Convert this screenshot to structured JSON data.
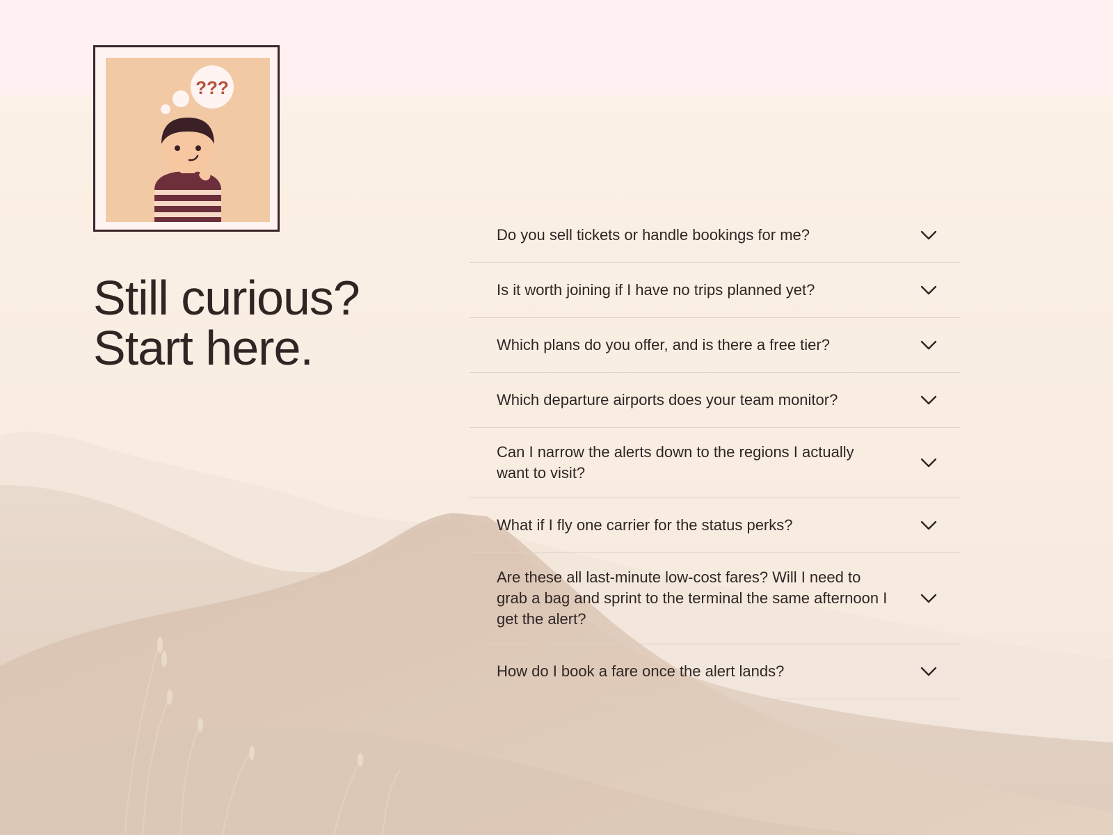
{
  "colors": {
    "top_band": "#fff0f1",
    "page_background": "#fbf1e6",
    "heading_text": "#2f2624",
    "divider": "#ddd1c8",
    "portrait_frame": "#3a2428",
    "portrait_bg": "#f2c9a5",
    "accent": "#b3503c"
  },
  "illustration": {
    "thought_text": "???",
    "icon": "curious-person-illustration"
  },
  "heading": {
    "line1": "Still curious?",
    "line2": "Start here."
  },
  "faq": {
    "chevron_icon": "chevron-down-icon",
    "items": [
      {
        "question": "Do you sell tickets or handle bookings for me?"
      },
      {
        "question": "Is it worth joining if I have no trips planned yet?"
      },
      {
        "question": "Which plans do you offer, and is there a free tier?"
      },
      {
        "question": "Which departure airports does your team monitor?"
      },
      {
        "question": "Can I narrow the alerts down to the regions I actually want to visit?"
      },
      {
        "question": "What if I fly one carrier for the status perks?"
      },
      {
        "question": "Are these all last-minute low-cost fares? Will I need to grab a bag and sprint to the terminal the same afternoon I get the alert?"
      },
      {
        "question": "How do I book a fare once the alert lands?"
      }
    ]
  }
}
